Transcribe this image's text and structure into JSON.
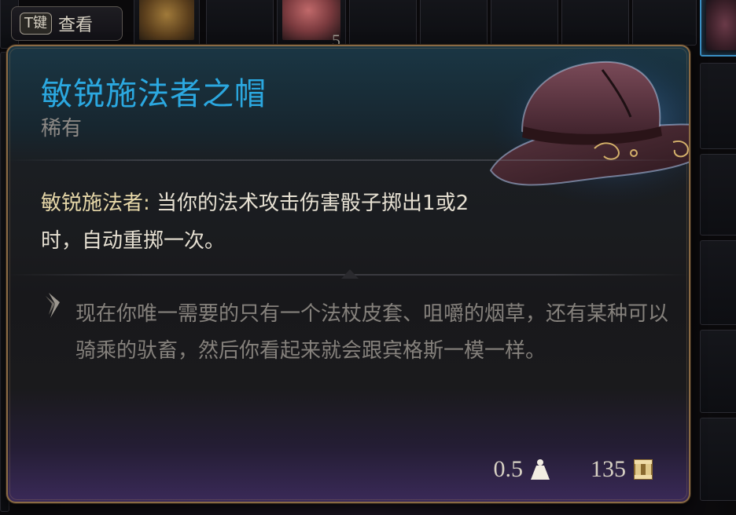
{
  "inspect_hint": {
    "key": "T键",
    "label": "查看"
  },
  "inventory": {
    "stack_count": "5"
  },
  "tooltip": {
    "name": "敏锐施法者之帽",
    "rarity": "稀有",
    "effect": {
      "name": "敏锐施法者:",
      "description": " 当你的法术攻击伤害骰子掷出1或2时，自动重掷一次。"
    },
    "flavor": "现在你唯一需要的只有一个法杖皮套、咀嚼的烟草，还有某种可以骑乘的驮畜，然后你看起来就会跟宾格斯一模一样。",
    "weight": "0.5",
    "value": "135",
    "icons": {
      "weight": "weight-icon",
      "value": "gold-icon",
      "flavor": "quote-icon",
      "item": "hat-icon"
    }
  },
  "colors": {
    "name": "#2ba8e0",
    "border": "#8a6a44",
    "gold": "#e0c88a"
  }
}
